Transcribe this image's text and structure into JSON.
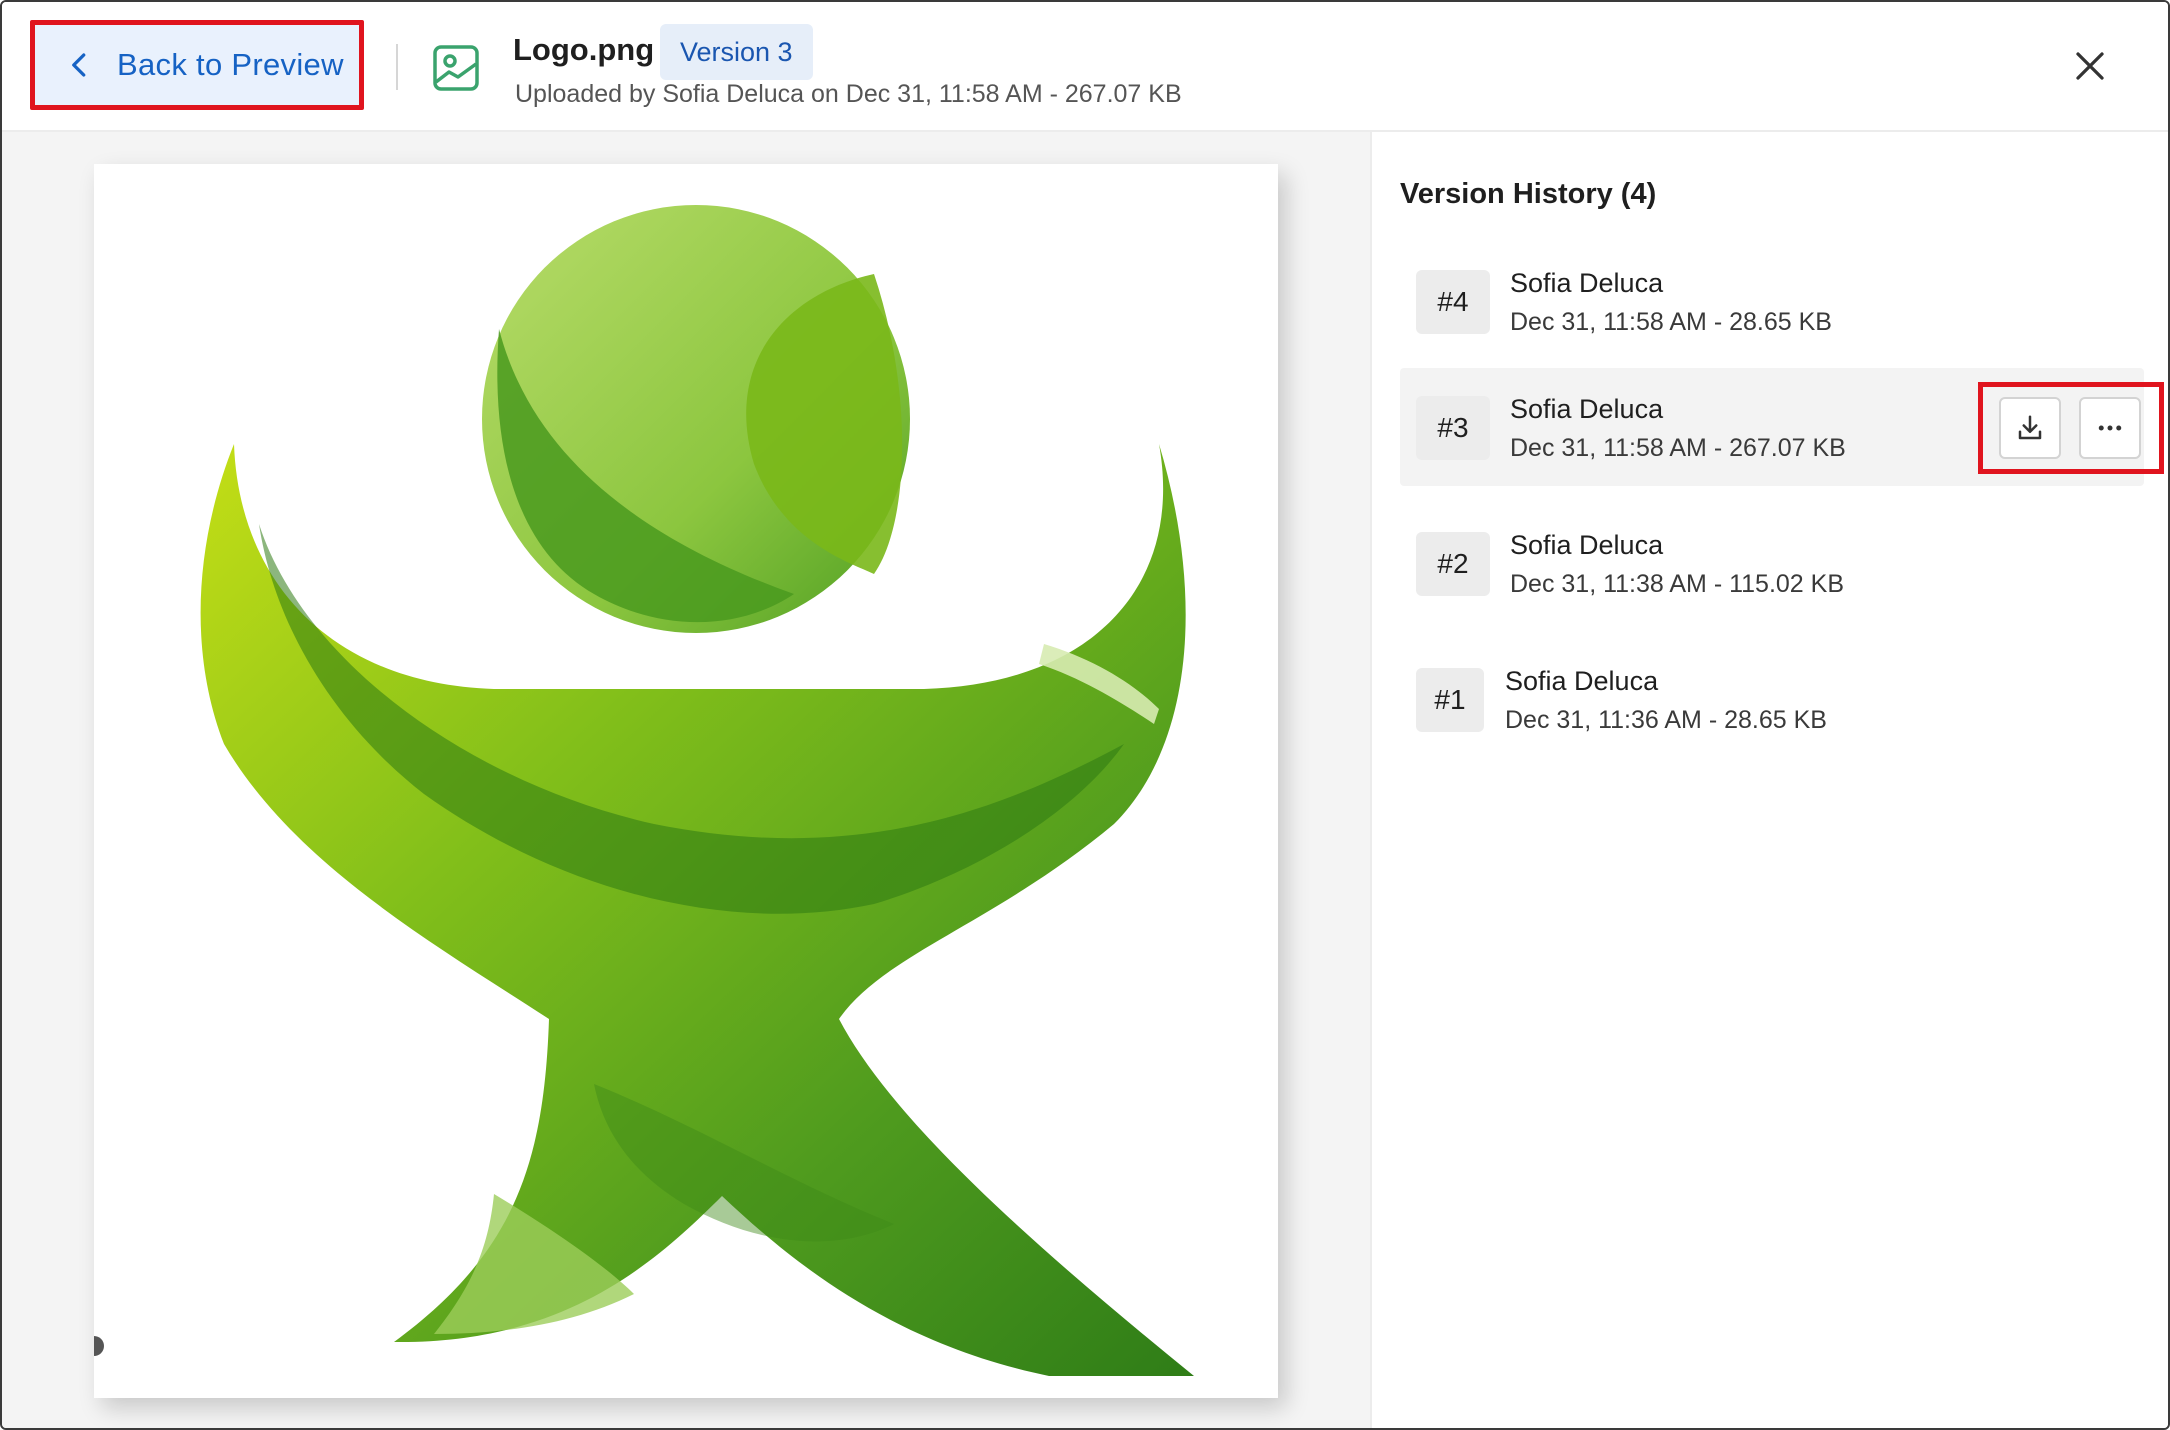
{
  "header": {
    "back_label": "Back to Preview",
    "file_name": "Logo.png",
    "version_badge": "Version 3",
    "file_meta": "Uploaded by Sofia Deluca on Dec 31, 11:58 AM - 267.07 KB"
  },
  "panel": {
    "title": "Version History (4)",
    "versions": [
      {
        "num": "#4",
        "name": "Sofia Deluca",
        "meta": "Dec 31, 11:58 AM - 28.65 KB",
        "active": false
      },
      {
        "num": "#3",
        "name": "Sofia Deluca",
        "meta": "Dec 31, 11:58 AM - 267.07 KB",
        "active": true
      },
      {
        "num": "#2",
        "name": "Sofia Deluca",
        "meta": "Dec 31, 11:38 AM - 115.02 KB",
        "active": false
      },
      {
        "num": "#1",
        "name": "Sofia Deluca",
        "meta": "Dec 31, 11:36 AM - 28.65 KB",
        "active": false
      }
    ]
  },
  "icons": {
    "back": "chevron-left-icon",
    "file": "image-file-icon",
    "close": "close-icon",
    "download": "download-icon",
    "more": "more-horizontal-icon"
  },
  "colors": {
    "accent": "#1662c4",
    "highlight_border": "#e0141e",
    "badge_bg": "#e6eef9",
    "logo_green": "#5aa823"
  }
}
